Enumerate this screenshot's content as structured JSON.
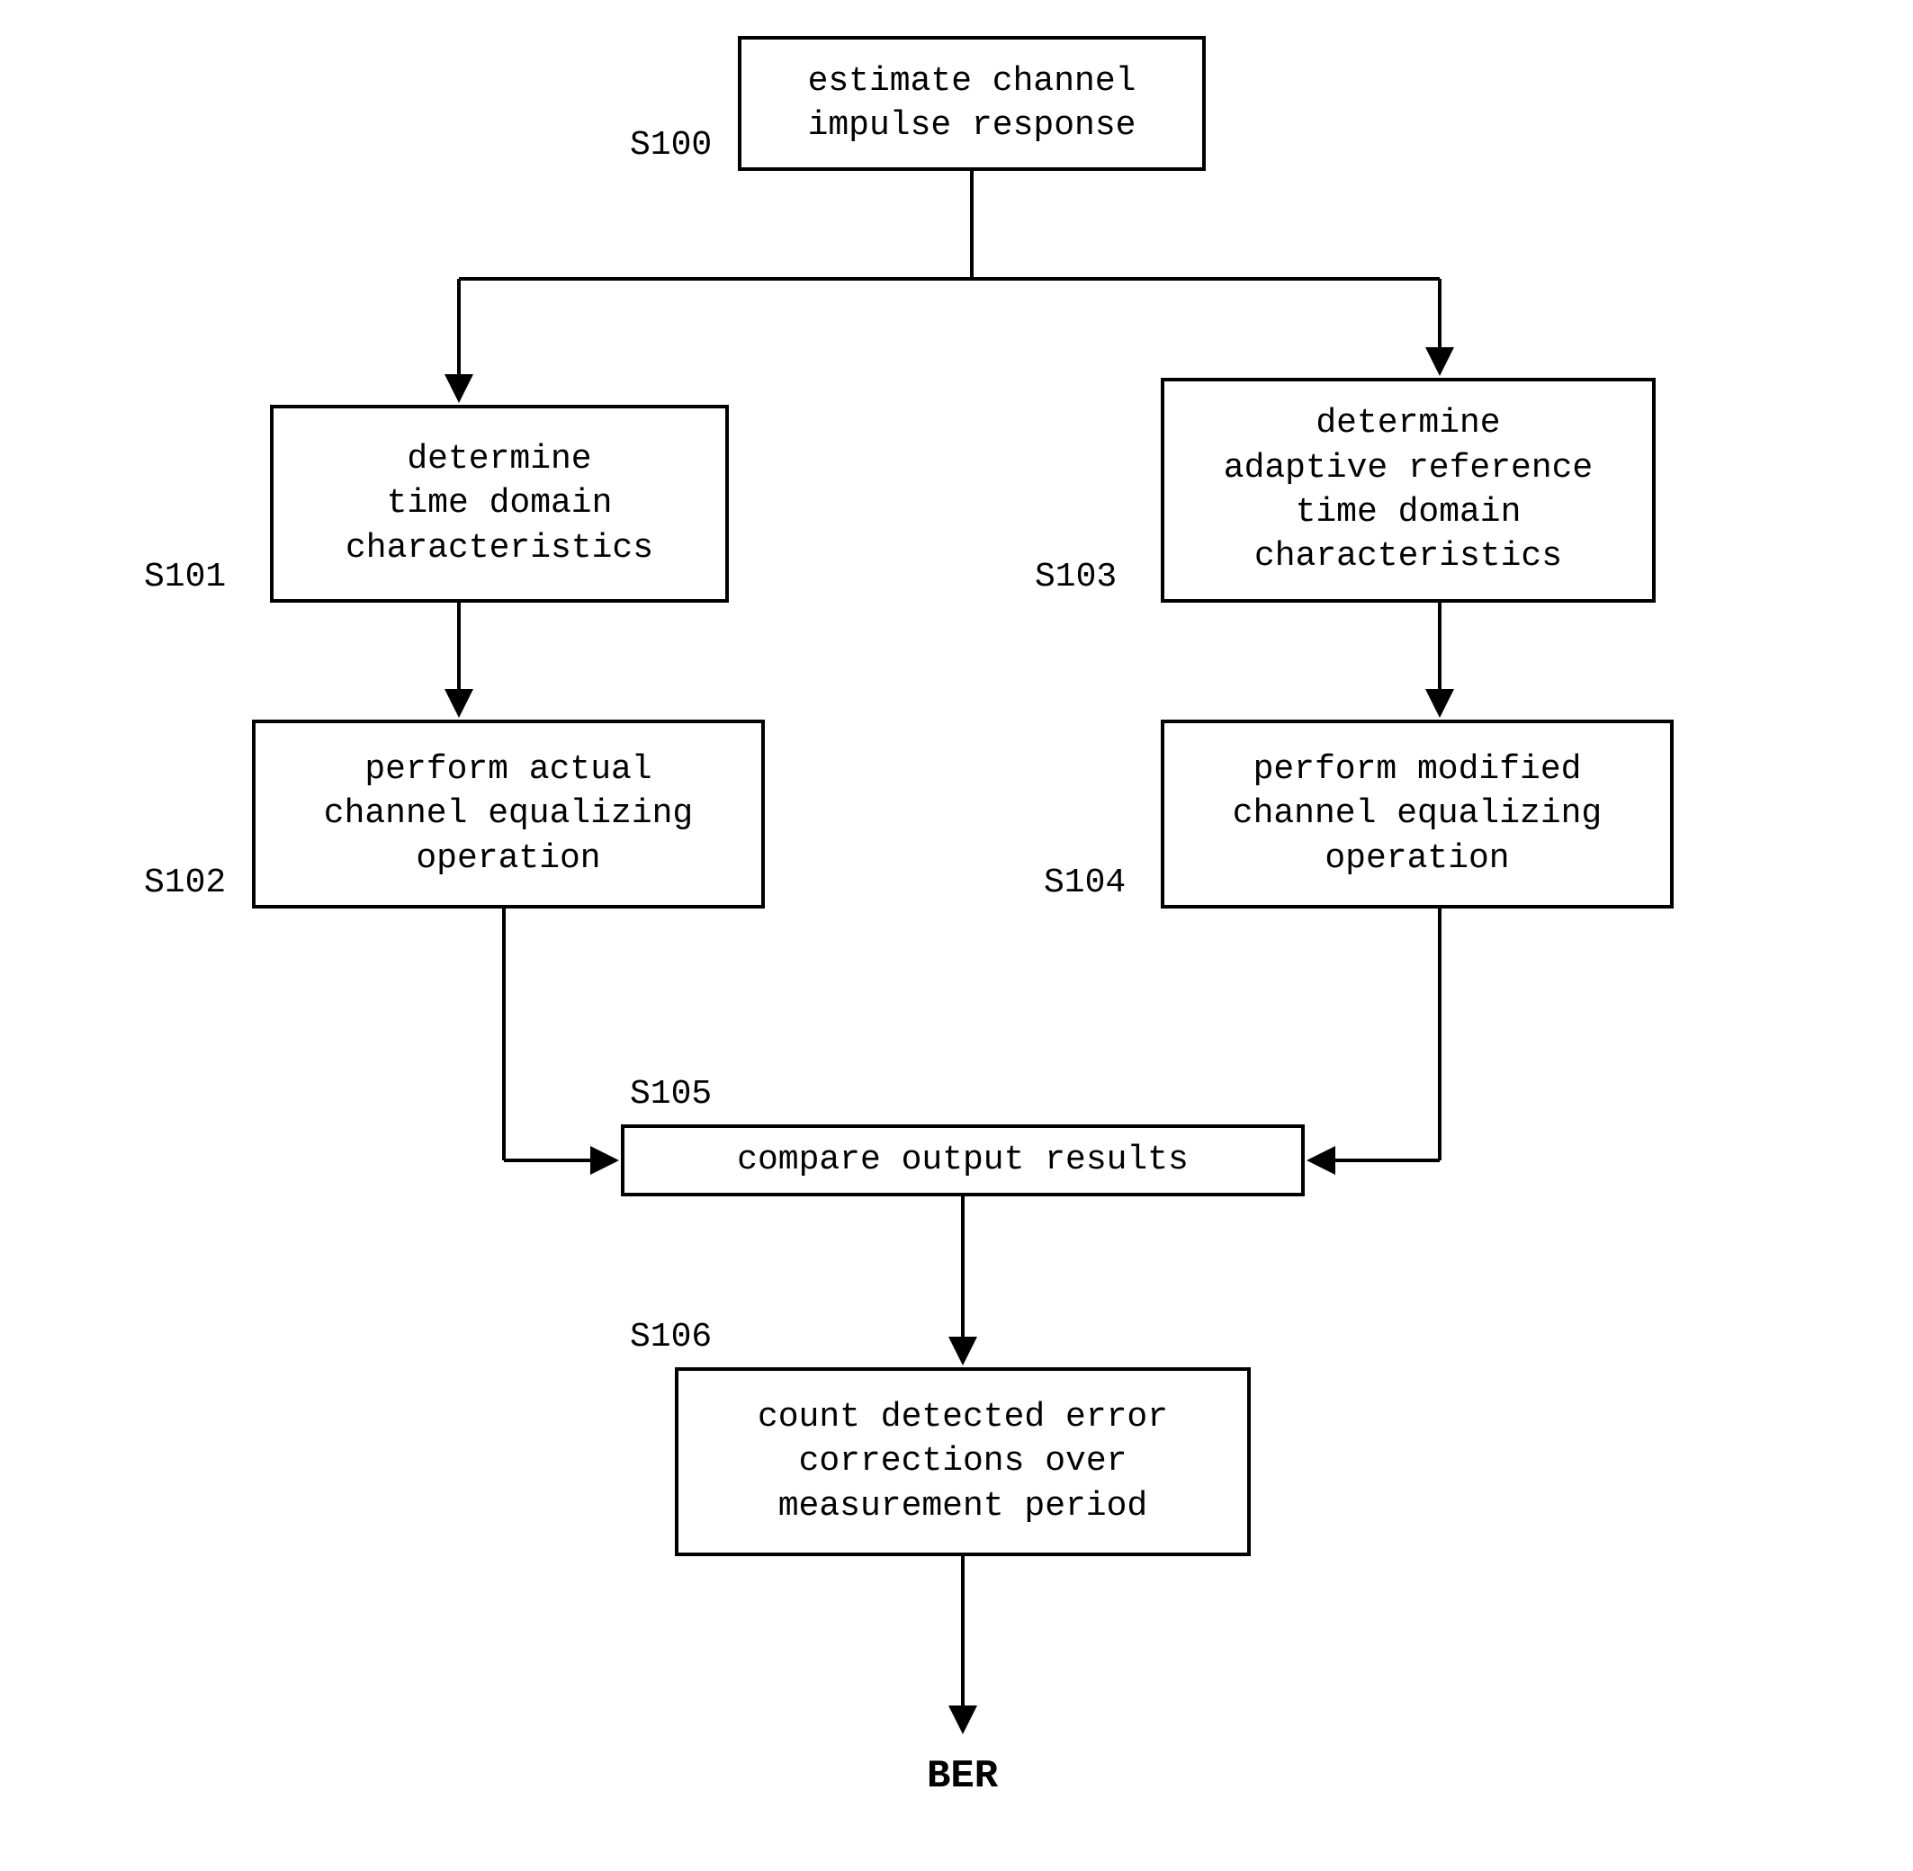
{
  "nodes": {
    "s100": {
      "label": "S100",
      "text": "estimate channel\nimpulse response"
    },
    "s101": {
      "label": "S101",
      "text": "determine\ntime domain\ncharacteristics"
    },
    "s102": {
      "label": "S102",
      "text": "perform actual\nchannel equalizing\noperation"
    },
    "s103": {
      "label": "S103",
      "text": "determine\nadaptive reference\ntime domain\ncharacteristics"
    },
    "s104": {
      "label": "S104",
      "text": "perform modified\nchannel equalizing\noperation"
    },
    "s105": {
      "label": "S105",
      "text": "compare output results"
    },
    "s106": {
      "label": "S106",
      "text": "count detected error\ncorrections over\nmeasurement period"
    }
  },
  "output": "BER"
}
